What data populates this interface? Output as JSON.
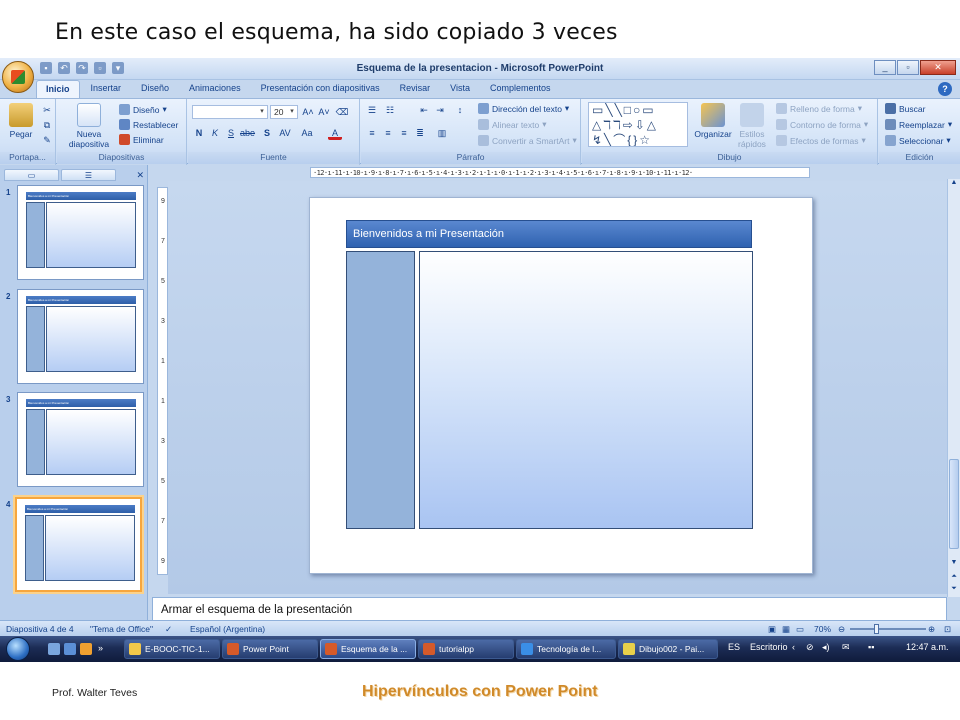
{
  "slide_heading": "En este caso el esquema, ha sido copiado 3 veces",
  "window": {
    "title": "Esquema de la presentacion - Microsoft PowerPoint",
    "min": "_",
    "max": "▫",
    "close": "✕"
  },
  "tabs": [
    "Inicio",
    "Insertar",
    "Diseño",
    "Animaciones",
    "Presentación con diapositivas",
    "Revisar",
    "Vista",
    "Complementos"
  ],
  "ribbon": {
    "portapapeles": {
      "label": "Portapa...",
      "pegar": "Pegar"
    },
    "diapositivas": {
      "label": "Diapositivas",
      "nueva": "Nueva diapositiva",
      "diseno": "Diseño",
      "restablecer": "Restablecer",
      "eliminar": "Eliminar"
    },
    "fuente": {
      "label": "Fuente",
      "font_size": "20"
    },
    "parrafo": {
      "label": "Párrafo",
      "direccion": "Dirección del texto",
      "alinear": "Alinear texto",
      "convertir": "Convertir a SmartArt"
    },
    "dibujo": {
      "label": "Dibujo",
      "organizar": "Organizar",
      "estilos": "Estilos rápidos",
      "relleno": "Relleno de forma",
      "contorno": "Contorno de forma",
      "efectos": "Efectos de formas"
    },
    "edicion": {
      "label": "Edición",
      "buscar": "Buscar",
      "reemplazar": "Reemplazar",
      "seleccionar": "Seleccionar"
    }
  },
  "ruler_h": "·12·ı·11·ı·10·ı·9·ı·8·ı·7·ı·6·ı·5·ı·4·ı·3·ı·2·ı·1·ı·0·ı·1·ı·2·ı·3·ı·4·ı·5·ı·6·ı·7·ı·8·ı·9·ı·10·ı·11·ı·12·",
  "thumbnails": [
    {
      "num": "1",
      "title": "Bienvenidos a mi Presentación"
    },
    {
      "num": "2",
      "title": "Bienvenidos a mi Presentación"
    },
    {
      "num": "3",
      "title": "Bienvenidos a mi Presentación"
    },
    {
      "num": "4",
      "title": "Bienvenidos a mi Presentación"
    }
  ],
  "slide": {
    "title": "Bienvenidos a mi Presentación"
  },
  "notes": "Armar el esquema de la presentación",
  "status": {
    "slide_count": "Diapositiva 4 de 4",
    "theme": "\"Tema de Office\"",
    "language": "Español (Argentina)",
    "zoom": "70%"
  },
  "taskbar": {
    "items": [
      "E-BOOC-TIC-1...",
      "Power Point",
      "Esquema de la ...",
      "tutorialpp",
      "Tecnología de l...",
      "Dibujo002 - Pai..."
    ],
    "lang": "ES",
    "escritorio": "Escritorio",
    "time": "12:47 a.m."
  },
  "footer": {
    "author": "Prof. Walter Teves",
    "title": "Hipervínculos con Power Point"
  },
  "colors": {
    "accent": "#2f62b0",
    "footer_title": "#d08a2a",
    "selection": "#f6a63e"
  }
}
